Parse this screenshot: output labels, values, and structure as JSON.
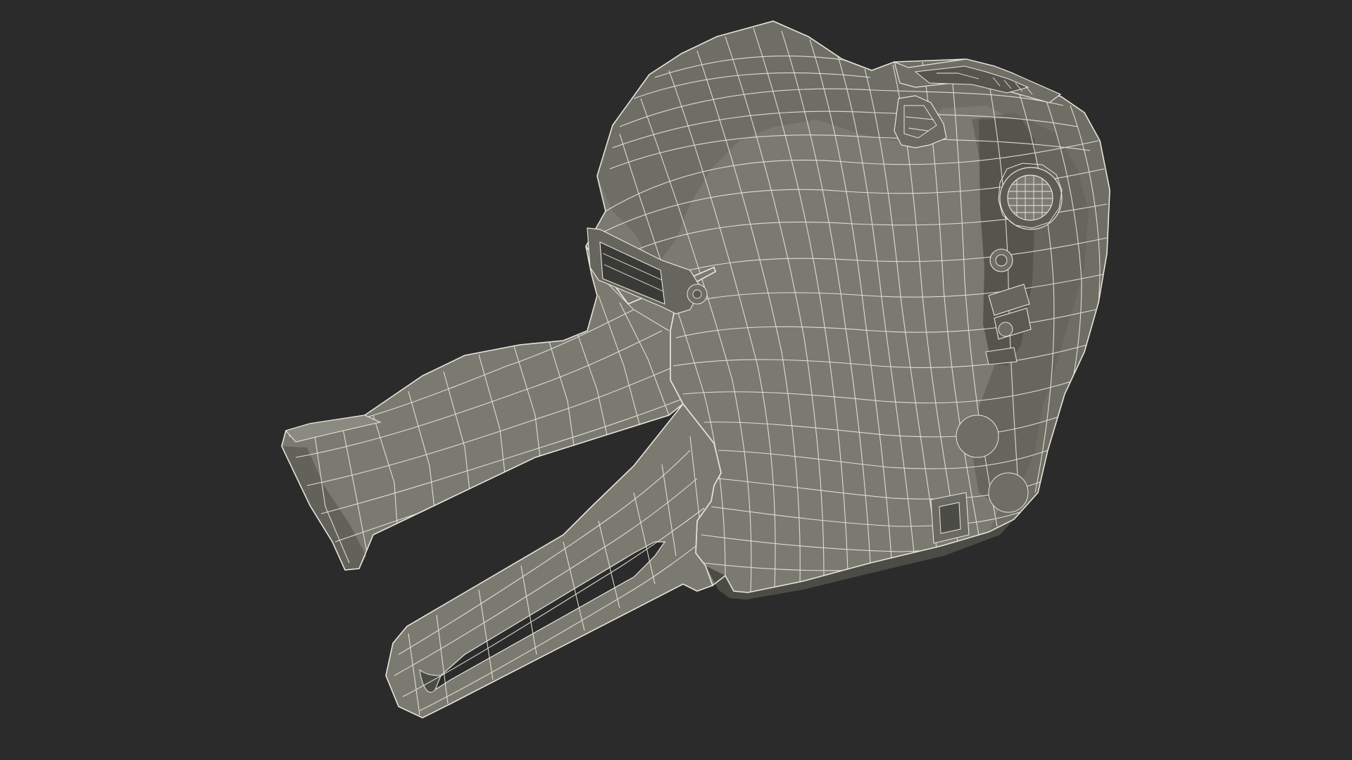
{
  "scene": {
    "subject": "price-labeler-gun",
    "render_style": "wireframe-on-shaded",
    "colors": {
      "background": "#2b2b2b",
      "surface": "#7a7a70",
      "surface_dark": "#5f5f57",
      "surface_shadow": "#4c4c46",
      "surface_light": "#8c8c82",
      "wire": "#e6e6dc",
      "cavity": "#3a3a36"
    }
  }
}
